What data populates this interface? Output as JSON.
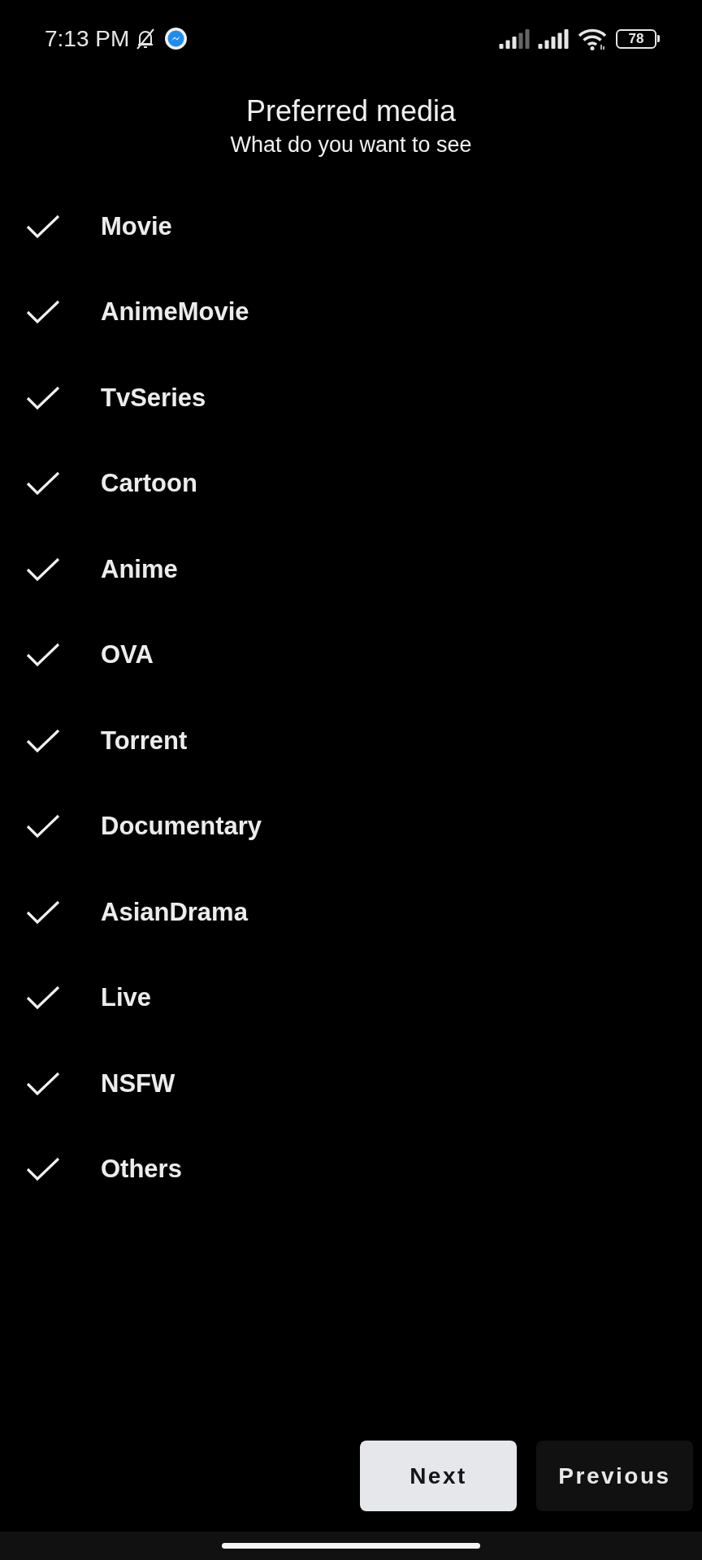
{
  "status_bar": {
    "time": "7:13 PM",
    "battery": "78"
  },
  "header": {
    "title": "Preferred media",
    "subtitle": "What do you want to see"
  },
  "media_types": [
    {
      "label": "Movie",
      "checked": true
    },
    {
      "label": "AnimeMovie",
      "checked": true
    },
    {
      "label": "TvSeries",
      "checked": true
    },
    {
      "label": "Cartoon",
      "checked": true
    },
    {
      "label": "Anime",
      "checked": true
    },
    {
      "label": "OVA",
      "checked": true
    },
    {
      "label": "Torrent",
      "checked": true
    },
    {
      "label": "Documentary",
      "checked": true
    },
    {
      "label": "AsianDrama",
      "checked": true
    },
    {
      "label": "Live",
      "checked": true
    },
    {
      "label": "NSFW",
      "checked": true
    },
    {
      "label": "Others",
      "checked": true
    }
  ],
  "buttons": [
    {
      "label": "Next",
      "kind": "primary"
    },
    {
      "label": "Previous",
      "kind": "secondary"
    }
  ]
}
